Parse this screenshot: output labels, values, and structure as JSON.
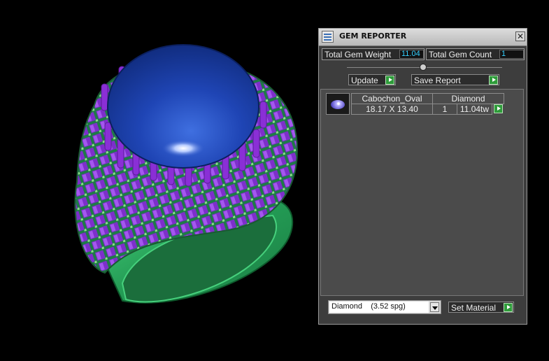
{
  "window": {
    "title": "GEM REPORTER",
    "close_label": "✕"
  },
  "stats": {
    "weight_label": "Total Gem Weight",
    "weight_value": "11.04",
    "count_label": "Total Gem Count",
    "count_value": "1"
  },
  "toolbar": {
    "update_label": "Update",
    "save_label": "Save Report"
  },
  "gems": [
    {
      "shape": "Cabochon_Oval",
      "material": "Diamond",
      "size": "18.17 X 13.40",
      "qty": "1",
      "weight": "11.04tw"
    }
  ],
  "footer": {
    "material_selected": "Diamond    (3.52 spg)",
    "set_material_label": "Set Material"
  },
  "colors": {
    "accent_value": "#35d0ff",
    "go_button": "#2e9c3a",
    "ring_metal": "#2fb56a",
    "center_stone": "#1e3fa8",
    "side_stones": "#7a2bc4"
  },
  "icons": {
    "app": "gem-reporter-icon",
    "close": "close-icon",
    "go": "play-arrow-icon",
    "gem": "oval-gem-icon",
    "dropdown": "chevron-down-icon"
  }
}
